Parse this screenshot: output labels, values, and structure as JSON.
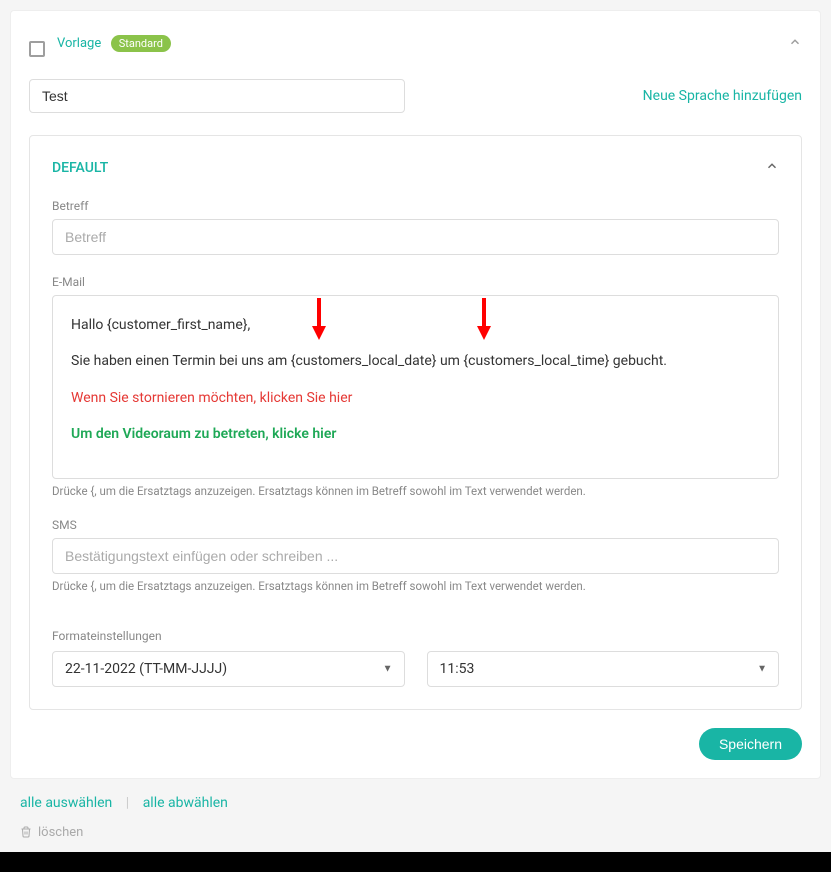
{
  "header": {
    "template_label": "Vorlage",
    "standard_badge": "Standard"
  },
  "name_input": {
    "value": "Test"
  },
  "add_language": "Neue Sprache hinzufügen",
  "panel": {
    "title": "DEFAULT",
    "subject": {
      "label": "Betreff",
      "placeholder": "Betreff"
    },
    "email": {
      "label": "E-Mail",
      "greeting": "Hallo {customer_first_name},",
      "body_line": "Sie haben einen Termin bei uns am {customers_local_date} um {customers_local_time} gebucht.",
      "cancel_line": "Wenn Sie stornieren möchten, klicken Sie hier",
      "video_line": "Um den Videoraum zu betreten, klicke hier",
      "hint": "Drücke {, um die Ersatztags anzuzeigen. Ersatztags können im Betreff sowohl im Text verwendet werden."
    },
    "sms": {
      "label": "SMS",
      "placeholder": "Bestätigungstext einfügen oder schreiben ...",
      "hint": "Drücke {, um die Ersatztags anzuzeigen. Ersatztags können im Betreff sowohl im Text verwendet werden."
    },
    "format": {
      "label": "Formateinstellungen",
      "date_value": "22-11-2022 (TT-MM-JJJJ)",
      "time_value": "11:53"
    }
  },
  "save_button": "Speichern",
  "footer": {
    "select_all": "alle auswählen",
    "deselect_all": "alle abwählen",
    "delete": "löschen"
  }
}
